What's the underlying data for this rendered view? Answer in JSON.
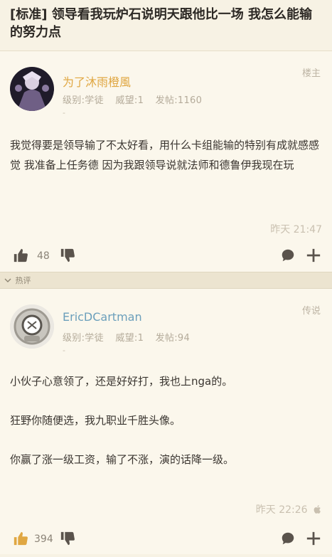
{
  "thread": {
    "title": "[标准] 领导看我玩炉石说明天跟他比一场 我怎么能输的努力点"
  },
  "op_post": {
    "username": "为了沐雨橙風",
    "level": "级别:学徒",
    "reputation": "威望:1",
    "posts": "发帖:1160",
    "dash": "-",
    "floor": "楼主",
    "content": "我觉得要是领导输了不太好看，用什么卡组能输的特别有成就感感觉 我准备上任务德 因为我跟领导说就法师和德鲁伊我现在玩",
    "timestamp": "昨天 21:47",
    "likes": "48"
  },
  "section": {
    "hot_label": "热评"
  },
  "reply_post": {
    "username": "EricDCartman",
    "level": "级别:学徒",
    "reputation": "威望:1",
    "posts": "发帖:94",
    "dash": "-",
    "floor": "传说",
    "paragraphs": [
      "小伙子心意领了，还是好好打，我也上nga的。",
      "狂野你随便选，我九职业千胜头像。",
      "你赢了涨一级工资，输了不涨，演的话降一级。"
    ],
    "timestamp": "昨天 22:26",
    "likes": "394"
  },
  "icons": {
    "like": "thumb-up-icon",
    "dislike": "thumb-down-icon",
    "comment": "comment-icon",
    "add": "plus-icon",
    "apple": "apple-icon",
    "chevron": "chevron-down-icon"
  },
  "colors": {
    "background": "#f7f2e4",
    "username_gold": "#e0a742",
    "username_blue": "#6b9fbb",
    "icon_gray": "#5a534c"
  }
}
